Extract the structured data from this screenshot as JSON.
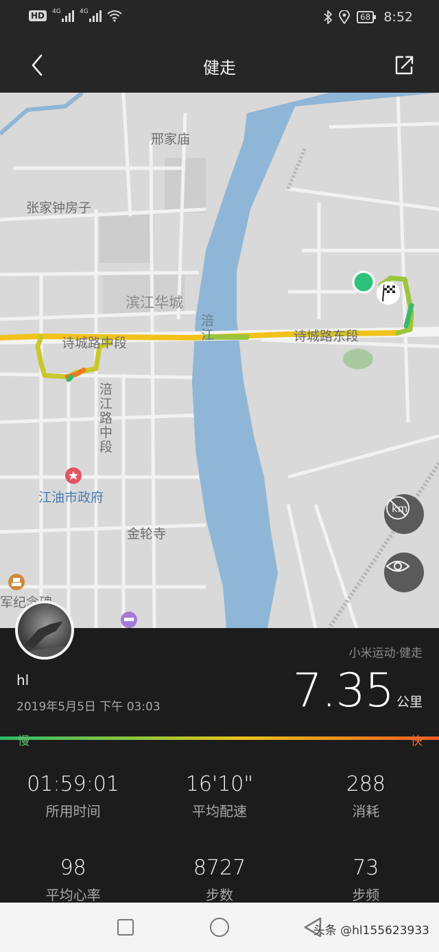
{
  "status_bar": {
    "hd_label": "HD",
    "net_1": "4G",
    "net_2": "4G",
    "battery": "68",
    "time": "8:52",
    "icons": [
      "hd-icon",
      "signal-icon",
      "signal-icon",
      "wifi-icon",
      "bluetooth-icon",
      "location-icon",
      "battery-icon"
    ]
  },
  "header": {
    "title": "健走",
    "back_icon": "chevron-left-icon",
    "share_icon": "share-icon"
  },
  "map": {
    "labels": {
      "xingjiamiao": "邢家庙",
      "zhangjiazhong": "张家钟房子",
      "binjiang": "滨江华城",
      "fu_river": "涪江",
      "shicheng_mid": "诗城路中段",
      "shicheng_east": "诗城路东段",
      "fujiang_road": "涪江路中段",
      "gov": "江油市政府",
      "jinlunsi": "金轮寺",
      "memorial": "军纪念碑"
    },
    "route_colors": {
      "slow": "#3cb86a",
      "mid": "#f2c21b",
      "fast": "#f07a20"
    },
    "controls": {
      "km_toggle_icon": "km-marker-off-icon",
      "visibility_icon": "eye-icon"
    }
  },
  "activity": {
    "source": "小米运动·健走",
    "user": "hl",
    "date": "2019年5月5日 下午 03:03",
    "distance": "7.35",
    "distance_unit": "公里",
    "speed_slow": "慢",
    "speed_fast": "快",
    "stats": [
      {
        "value": "01:59:01",
        "label": "所用时间"
      },
      {
        "value": "16'10\"",
        "label": "平均配速"
      },
      {
        "value": "288",
        "label": "消耗"
      },
      {
        "value": "98",
        "label": "平均心率"
      },
      {
        "value": "8727",
        "label": "步数"
      },
      {
        "value": "73",
        "label": "步频"
      }
    ]
  },
  "nav_bar": {
    "watermark": "头条 @hl15562393​3"
  }
}
